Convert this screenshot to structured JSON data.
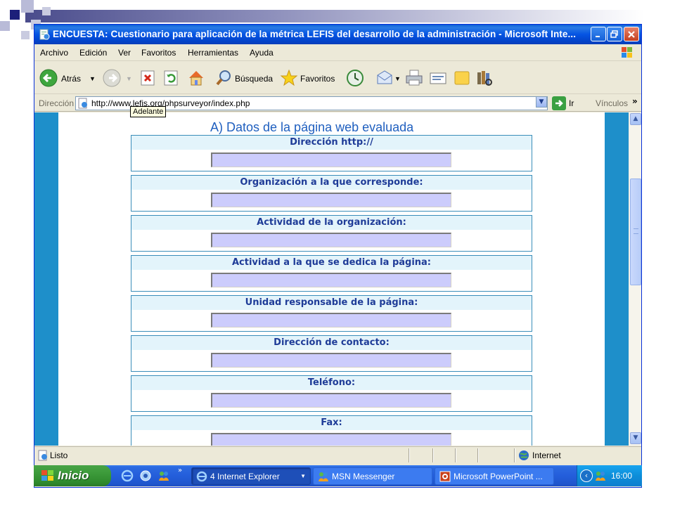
{
  "window": {
    "title": "ENCUESTA: Cuestionario para aplicación de la métrica LEFIS del desarrollo de la administración  - Microsoft Inte...",
    "controls": [
      "minimize",
      "maximize",
      "close"
    ]
  },
  "menu": {
    "items": [
      "Archivo",
      "Edición",
      "Ver",
      "Favoritos",
      "Herramientas",
      "Ayuda"
    ]
  },
  "toolbar": {
    "back_label": "Atrás",
    "search_label": "Búsqueda",
    "favorites_label": "Favoritos"
  },
  "address": {
    "label": "Dirección",
    "url": "http://www.lefis.org/phpsurveyor/index.php",
    "go_label": "Ir",
    "links_label": "Vínculos",
    "links_more": "»"
  },
  "tooltip": {
    "text": "Adelante"
  },
  "page": {
    "section_title": "A) Datos de la página web evaluada",
    "fields": [
      {
        "label": "Dirección http://",
        "value": ""
      },
      {
        "label": "Organización a la que corresponde:",
        "value": ""
      },
      {
        "label": "Actividad de la organización:",
        "value": ""
      },
      {
        "label": "Actividad a la que se dedica la página:",
        "value": ""
      },
      {
        "label": "Unidad responsable de la página:",
        "value": ""
      },
      {
        "label": "Dirección de contacto:",
        "value": ""
      },
      {
        "label": "Teléfono:",
        "value": ""
      },
      {
        "label": "Fax:",
        "value": ""
      }
    ]
  },
  "status": {
    "text": "Listo",
    "zone": "Internet"
  },
  "taskbar": {
    "start_label": "Inicio",
    "tasks": [
      {
        "label": "4 Internet Explorer"
      },
      {
        "label": "MSN Messenger"
      },
      {
        "label": "Microsoft PowerPoint ..."
      }
    ],
    "quicklaunch_more": "»",
    "clock": "16:00"
  },
  "colors": {
    "page_frame": "#1e8fca",
    "field_header_bg": "#e3f4fb",
    "field_header_text": "#1f3c98",
    "input_bg": "#ccccfc",
    "section_title": "#1f5fbf"
  }
}
